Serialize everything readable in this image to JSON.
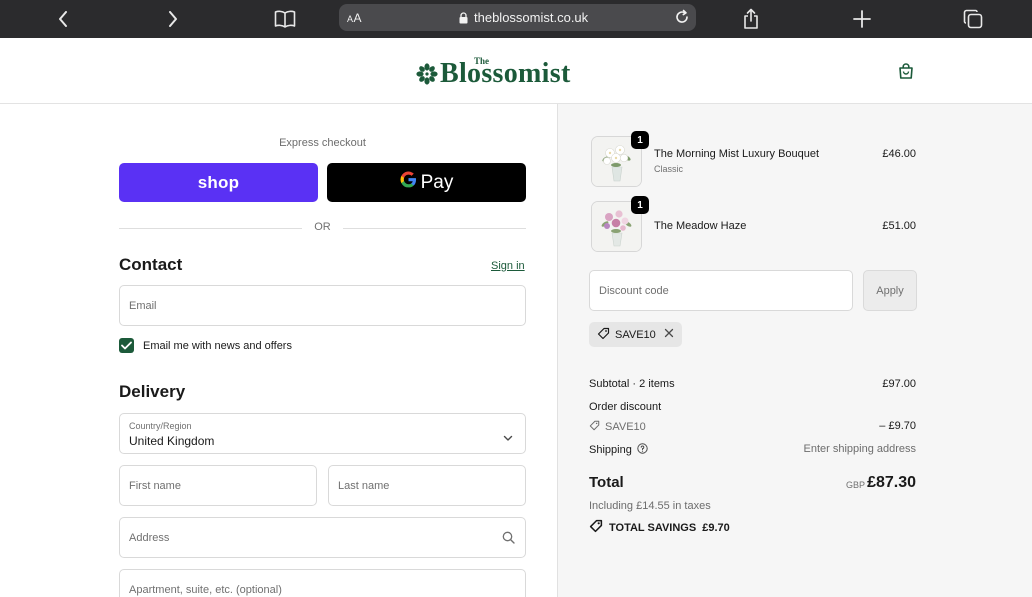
{
  "browser": {
    "url": "theblossomist.co.uk",
    "aa_label_big": "A",
    "aa_label_small": "A",
    "icons": [
      "back-icon",
      "forward-icon",
      "bookmarks-icon",
      "lock-icon",
      "reload-icon",
      "share-icon",
      "new-tab-icon",
      "tabs-icon"
    ]
  },
  "header": {
    "logo_prefix": "The",
    "logo_text": "Blossomist",
    "brand_color": "#1c5a3a"
  },
  "checkout": {
    "express_label": "Express checkout",
    "shop_label": "shop",
    "gpay_label": "Pay",
    "or_label": "OR",
    "contact": {
      "title": "Contact",
      "sign_in": "Sign in",
      "email_placeholder": "Email",
      "newsletter_label": "Email me with news and offers",
      "newsletter_checked": true
    },
    "delivery": {
      "title": "Delivery",
      "country_label": "Country/Region",
      "country_value": "United Kingdom",
      "first_name_placeholder": "First name",
      "last_name_placeholder": "Last name",
      "address_placeholder": "Address",
      "apartment_placeholder": "Apartment, suite, etc. (optional)"
    }
  },
  "summary": {
    "items": [
      {
        "name": "The Morning Mist Luxury Bouquet",
        "variant": "Classic",
        "price": "£46.00",
        "qty": "1"
      },
      {
        "name": "The Meadow Haze",
        "variant": "",
        "price": "£51.00",
        "qty": "1"
      }
    ],
    "discount_placeholder": "Discount code",
    "apply_label": "Apply",
    "applied_code": "SAVE10",
    "subtotal_label": "Subtotal · 2 items",
    "subtotal_value": "£97.00",
    "order_discount_label": "Order discount",
    "order_discount_code": "SAVE10",
    "order_discount_value": "– £9.70",
    "shipping_label": "Shipping",
    "shipping_value": "Enter shipping address",
    "total_label": "Total",
    "total_currency": "GBP",
    "total_value": "£87.30",
    "tax_note": "Including £14.55 in taxes",
    "savings_label": "TOTAL SAVINGS",
    "savings_value": "£9.70"
  }
}
